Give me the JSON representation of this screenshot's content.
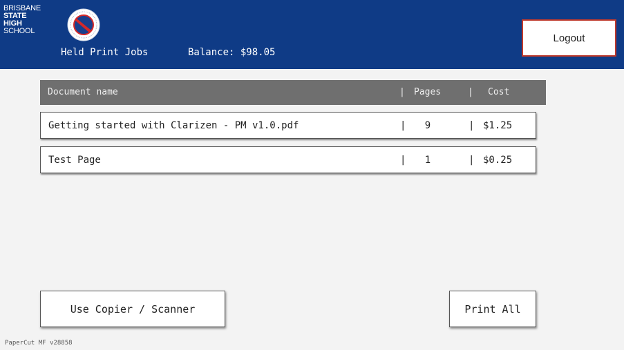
{
  "header": {
    "logo_lines": [
      "BRISBANE",
      "STATE",
      "HIGH",
      "SCHOOL"
    ],
    "title": "Held Print Jobs",
    "balance": "Balance: $98.05",
    "logout_label": "Logout"
  },
  "table": {
    "columns": [
      "Document name",
      "Pages",
      "Cost"
    ],
    "separator": "|",
    "rows": [
      {
        "name": "Getting started with Clarizen - PM v1.0.pdf",
        "pages": "9",
        "cost": "$1.25"
      },
      {
        "name": "Test Page",
        "pages": "1",
        "cost": "$0.25"
      }
    ]
  },
  "actions": {
    "copier_label": "Use Copier / Scanner",
    "print_all_label": "Print All"
  },
  "footer": {
    "version": "PaperCut MF v28858"
  },
  "colors": {
    "header_bg": "#0f3b86",
    "logout_border": "#c0392b",
    "table_header_bg": "#6f6f6f"
  }
}
